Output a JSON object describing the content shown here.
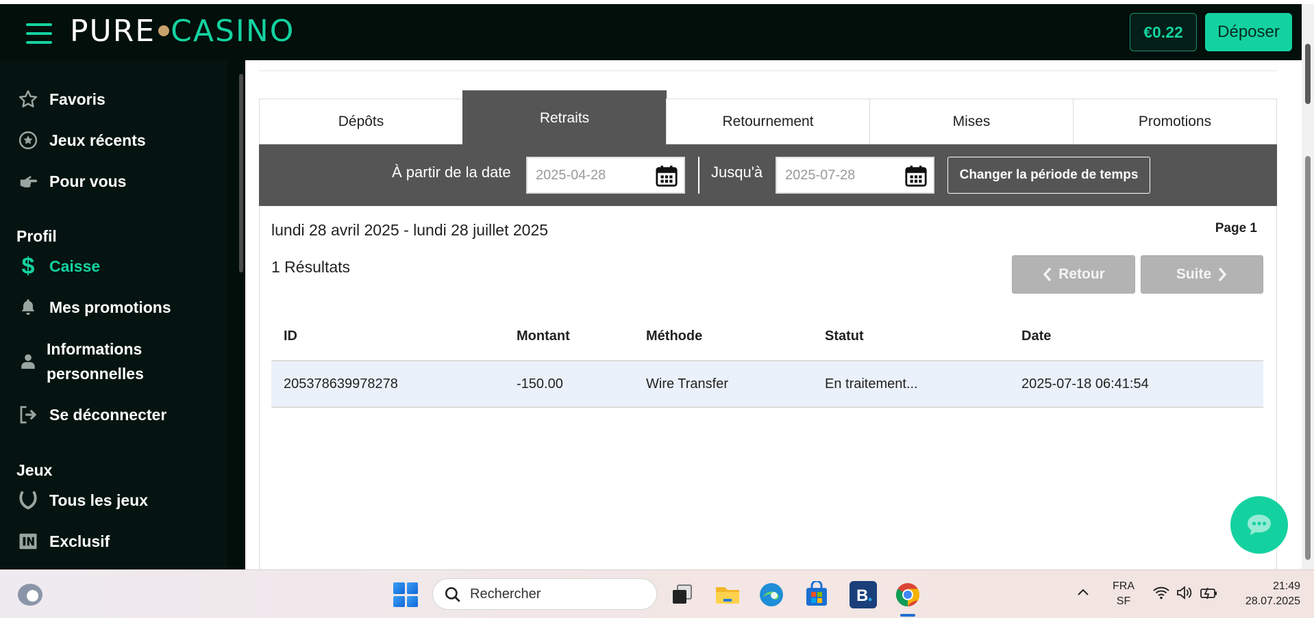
{
  "header": {
    "logo_pure": "PURE",
    "logo_casino": "CASINO",
    "balance": "€0.22",
    "deposit_label": "Déposer"
  },
  "sidebar": {
    "favorites": "Favoris",
    "recent_games": "Jeux récents",
    "for_you": "Pour vous",
    "profile_section": "Profil",
    "cashier": "Caisse",
    "my_promotions": "Mes promotions",
    "personal_info_line1": "Informations",
    "personal_info_line2": "personnelles",
    "logout": "Se déconnecter",
    "games_section": "Jeux",
    "all_games": "Tous les jeux",
    "exclusive": "Exclusif"
  },
  "tabs": [
    {
      "label": "Dépôts",
      "active": false
    },
    {
      "label": "Retraits",
      "active": true
    },
    {
      "label": "Retournement",
      "active": false
    },
    {
      "label": "Mises",
      "active": false
    },
    {
      "label": "Promotions",
      "active": false
    }
  ],
  "filter": {
    "from_label": "À partir de la date",
    "from_value": "2025-04-28",
    "to_label": "Jusqu'à",
    "to_value": "2025-07-28",
    "change_button": "Changer la période de temps"
  },
  "results": {
    "range_text": "lundi 28 avril 2025 - lundi 28 juillet 2025",
    "page_label": "Page 1",
    "count_text": "1 Résultats",
    "back_label": "Retour",
    "next_label": "Suite"
  },
  "table": {
    "headers": [
      "ID",
      "Montant",
      "Méthode",
      "Statut",
      "Date"
    ],
    "rows": [
      [
        "205378639978278",
        "-150.00",
        "Wire Transfer",
        "En traitement...",
        "2025-07-18 06:41:54"
      ]
    ]
  },
  "taskbar": {
    "search_placeholder": "Rechercher",
    "lang_line1": "FRA",
    "lang_line2": "SF",
    "time": "21:49",
    "date": "28.07.2025"
  },
  "colors": {
    "accent": "#14d2a0",
    "header_bg": "#020f0b",
    "tab_active": "#555555"
  }
}
